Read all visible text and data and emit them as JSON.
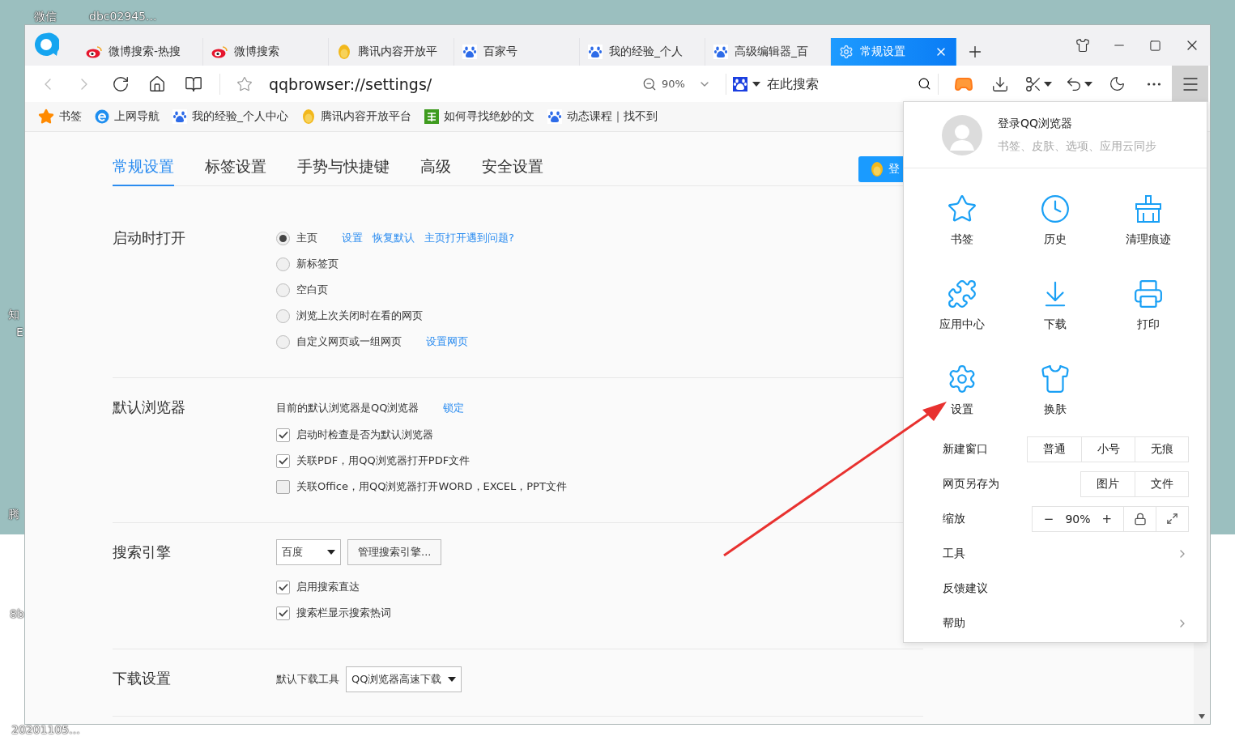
{
  "desktop": {
    "icon_labels": [
      {
        "label": "微信"
      },
      {
        "label": "dbc02945..."
      },
      {
        "label": "知"
      },
      {
        "label": "E"
      },
      {
        "label": "腾"
      },
      {
        "label": "8b"
      },
      {
        "label": "20201105..."
      }
    ]
  },
  "browser": {
    "tabs": [
      {
        "label": "微博搜索-热搜",
        "selected": false
      },
      {
        "label": "微博搜索",
        "selected": false
      },
      {
        "label": "腾讯内容开放平",
        "selected": false
      },
      {
        "label": "百家号",
        "selected": false
      },
      {
        "label": "我的经验_个人",
        "selected": false
      },
      {
        "label": "高级编辑器_百",
        "selected": false
      },
      {
        "label": "常规设置",
        "selected": true
      }
    ],
    "toolbar": {
      "address": "qqbrowser://settings/",
      "zoom": "90%",
      "search_placeholder": "在此搜索",
      "menu_open": true
    },
    "bookmarks": [
      {
        "label": "书签"
      },
      {
        "label": "上网导航"
      },
      {
        "label": "我的经验_个人中心"
      },
      {
        "label": "腾讯内容开放平台"
      },
      {
        "label": "如何寻找绝妙的文"
      },
      {
        "label": "动态课程｜找不到"
      }
    ]
  },
  "settings": {
    "nav": [
      {
        "label": "常规设置",
        "selected": true
      },
      {
        "label": "标签设置",
        "selected": false
      },
      {
        "label": "手势与快捷键",
        "selected": false
      },
      {
        "label": "高级",
        "selected": false
      },
      {
        "label": "安全设置",
        "selected": false
      }
    ],
    "login_button": "登",
    "sections": [
      {
        "title": "启动时打开",
        "items": [
          {
            "kind": "radio",
            "label": "主页",
            "selected": true,
            "links": [
              "设置",
              "恢复默认",
              "主页打开遇到问题?"
            ]
          },
          {
            "kind": "radio",
            "label": "新标签页",
            "selected": false
          },
          {
            "kind": "radio",
            "label": "空白页",
            "selected": false
          },
          {
            "kind": "radio",
            "label": "浏览上次关闭时在看的网页",
            "selected": false
          },
          {
            "kind": "radio",
            "label": "自定义网页或一组网页",
            "selected": false,
            "links": [
              "设置网页"
            ]
          }
        ]
      },
      {
        "title": "默认浏览器",
        "items": [
          {
            "kind": "text",
            "label": "目前的默认浏览器是QQ浏览器",
            "links": [
              "锁定"
            ]
          },
          {
            "kind": "checkbox",
            "label": "启动时检查是否为默认浏览器",
            "checked": true
          },
          {
            "kind": "checkbox",
            "label": "关联PDF，用QQ浏览器打开PDF文件",
            "checked": true
          },
          {
            "kind": "checkbox",
            "label": "关联Office，用QQ浏览器打开WORD，EXCEL，PPT文件",
            "checked": false
          }
        ]
      },
      {
        "title": "搜索引擎",
        "items": [
          {
            "kind": "select",
            "select": "百度",
            "button": "管理搜索引擎..."
          },
          {
            "kind": "checkbox",
            "label": "启用搜索直达",
            "checked": true
          },
          {
            "kind": "checkbox",
            "label": "搜索栏显示搜索热词",
            "checked": true
          }
        ]
      },
      {
        "title": "下载设置",
        "items": [
          {
            "kind": "labeled_select",
            "label": "默认下载工具",
            "select": "QQ浏览器高速下载"
          }
        ]
      }
    ]
  },
  "menu": {
    "account": {
      "title": "登录QQ浏览器",
      "subtitle": "书签、皮肤、选项、应用云同步"
    },
    "grid": [
      {
        "label": "书签"
      },
      {
        "label": "历史"
      },
      {
        "label": "清理痕迹"
      },
      {
        "label": "应用中心"
      },
      {
        "label": "下载"
      },
      {
        "label": "打印"
      },
      {
        "label": "设置"
      },
      {
        "label": "换肤"
      }
    ],
    "rows": [
      {
        "kind": "buttons",
        "label": "新建窗口",
        "buttons": [
          "普通",
          "小号",
          "无痕"
        ]
      },
      {
        "kind": "buttons",
        "label": "网页另存为",
        "buttons": [
          "图片",
          "文件"
        ]
      },
      {
        "kind": "zoom",
        "label": "缩放",
        "minus": "−",
        "value": "90%",
        "plus": "+"
      },
      {
        "kind": "submenu",
        "label": "工具"
      },
      {
        "kind": "plain",
        "label": "反馈建议"
      },
      {
        "kind": "submenu",
        "label": "帮助"
      }
    ]
  }
}
